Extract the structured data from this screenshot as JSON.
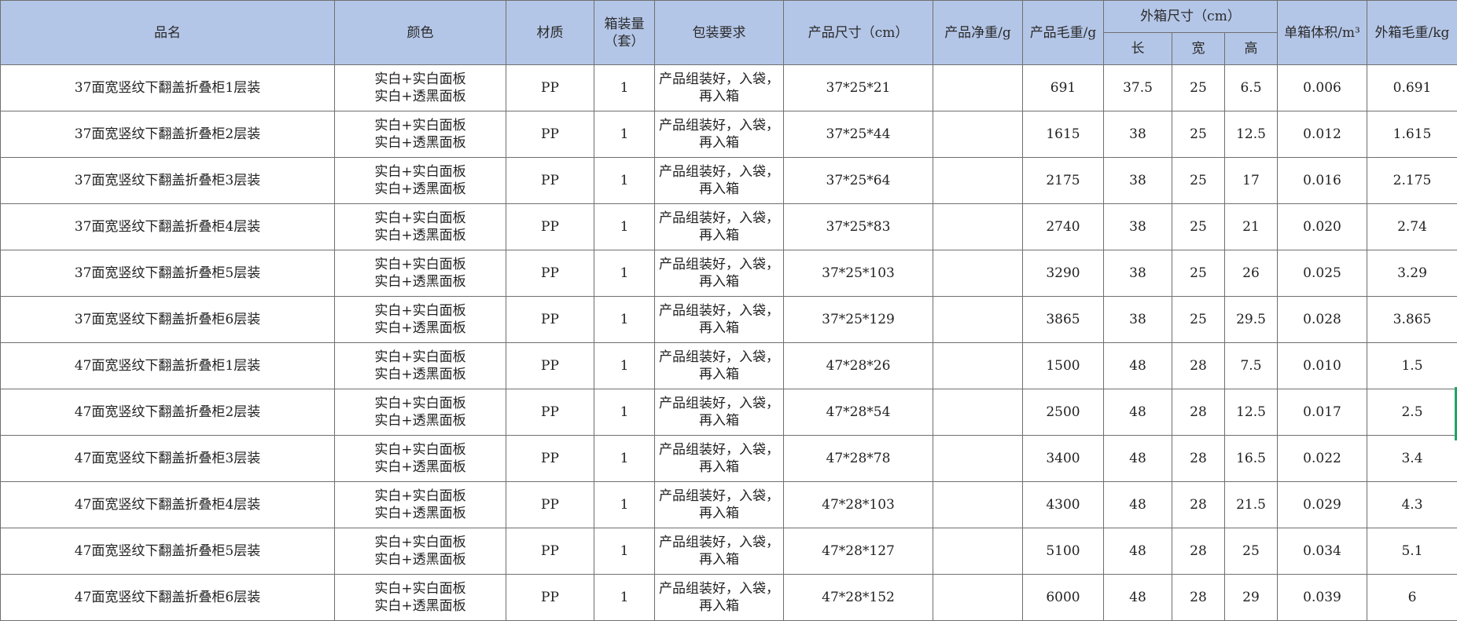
{
  "headers": {
    "name": "品名",
    "color": "颜色",
    "material": "材质",
    "qty": "箱装量（套）",
    "packing": "包装要求",
    "size": "产品尺寸（cm）",
    "net_weight": "产品净重/g",
    "gross_weight": "产品毛重/g",
    "carton_size": "外箱尺寸（cm）",
    "length": "长",
    "width": "宽",
    "height": "高",
    "volume": "单箱体积/m³",
    "carton_gross": "外箱毛重/kg"
  },
  "colors": {
    "header_bg": "#b4c6e7",
    "border": "#6f6f6f",
    "selection_mark": "#21a366"
  },
  "rows": [
    {
      "name": "37面宽竖纹下翻盖折叠柜1层装",
      "color1": "实白+实白面板",
      "color2": "实白+透黑面板",
      "material": "PP",
      "qty": "1",
      "packing": "产品组装好，入袋，再入箱",
      "size": "37*25*21",
      "net": "",
      "gross": "691",
      "l": "37.5",
      "w": "25",
      "h": "6.5",
      "vol": "0.006",
      "cgross": "0.691"
    },
    {
      "name": "37面宽竖纹下翻盖折叠柜2层装",
      "color1": "实白+实白面板",
      "color2": "实白+透黑面板",
      "material": "PP",
      "qty": "1",
      "packing": "产品组装好，入袋，再入箱",
      "size": "37*25*44",
      "net": "",
      "gross": "1615",
      "l": "38",
      "w": "25",
      "h": "12.5",
      "vol": "0.012",
      "cgross": "1.615"
    },
    {
      "name": "37面宽竖纹下翻盖折叠柜3层装",
      "color1": "实白+实白面板",
      "color2": "实白+透黑面板",
      "material": "PP",
      "qty": "1",
      "packing": "产品组装好，入袋，再入箱",
      "size": "37*25*64",
      "net": "",
      "gross": "2175",
      "l": "38",
      "w": "25",
      "h": "17",
      "vol": "0.016",
      "cgross": "2.175"
    },
    {
      "name": "37面宽竖纹下翻盖折叠柜4层装",
      "color1": "实白+实白面板",
      "color2": "实白+透黑面板",
      "material": "PP",
      "qty": "1",
      "packing": "产品组装好，入袋，再入箱",
      "size": "37*25*83",
      "net": "",
      "gross": "2740",
      "l": "38",
      "w": "25",
      "h": "21",
      "vol": "0.020",
      "cgross": "2.74"
    },
    {
      "name": "37面宽竖纹下翻盖折叠柜5层装",
      "color1": "实白+实白面板",
      "color2": "实白+透黑面板",
      "material": "PP",
      "qty": "1",
      "packing": "产品组装好，入袋，再入箱",
      "size": "37*25*103",
      "net": "",
      "gross": "3290",
      "l": "38",
      "w": "25",
      "h": "26",
      "vol": "0.025",
      "cgross": "3.29"
    },
    {
      "name": "37面宽竖纹下翻盖折叠柜6层装",
      "color1": "实白+实白面板",
      "color2": "实白+透黑面板",
      "material": "PP",
      "qty": "1",
      "packing": "产品组装好，入袋，再入箱",
      "size": "37*25*129",
      "net": "",
      "gross": "3865",
      "l": "38",
      "w": "25",
      "h": "29.5",
      "vol": "0.028",
      "cgross": "3.865"
    },
    {
      "name": "47面宽竖纹下翻盖折叠柜1层装",
      "color1": "实白+实白面板",
      "color2": "实白+透黑面板",
      "material": "PP",
      "qty": "1",
      "packing": "产品组装好，入袋，再入箱",
      "size": "47*28*26",
      "net": "",
      "gross": "1500",
      "l": "48",
      "w": "28",
      "h": "7.5",
      "vol": "0.010",
      "cgross": "1.5"
    },
    {
      "name": "47面宽竖纹下翻盖折叠柜2层装",
      "color1": "实白+实白面板",
      "color2": "实白+透黑面板",
      "material": "PP",
      "qty": "1",
      "packing": "产品组装好，入袋，再入箱",
      "size": "47*28*54",
      "net": "",
      "gross": "2500",
      "l": "48",
      "w": "28",
      "h": "12.5",
      "vol": "0.017",
      "cgross": "2.5"
    },
    {
      "name": "47面宽竖纹下翻盖折叠柜3层装",
      "color1": "实白+实白面板",
      "color2": "实白+透黑面板",
      "material": "PP",
      "qty": "1",
      "packing": "产品组装好，入袋，再入箱",
      "size": "47*28*78",
      "net": "",
      "gross": "3400",
      "l": "48",
      "w": "28",
      "h": "16.5",
      "vol": "0.022",
      "cgross": "3.4"
    },
    {
      "name": "47面宽竖纹下翻盖折叠柜4层装",
      "color1": "实白+实白面板",
      "color2": "实白+透黑面板",
      "material": "PP",
      "qty": "1",
      "packing": "产品组装好，入袋，再入箱",
      "size": "47*28*103",
      "net": "",
      "gross": "4300",
      "l": "48",
      "w": "28",
      "h": "21.5",
      "vol": "0.029",
      "cgross": "4.3"
    },
    {
      "name": "47面宽竖纹下翻盖折叠柜5层装",
      "color1": "实白+实白面板",
      "color2": "实白+透黑面板",
      "material": "PP",
      "qty": "1",
      "packing": "产品组装好，入袋，再入箱",
      "size": "47*28*127",
      "net": "",
      "gross": "5100",
      "l": "48",
      "w": "28",
      "h": "25",
      "vol": "0.034",
      "cgross": "5.1"
    },
    {
      "name": "47面宽竖纹下翻盖折叠柜6层装",
      "color1": "实白+实白面板",
      "color2": "实白+透黑面板",
      "material": "PP",
      "qty": "1",
      "packing": "产品组装好，入袋，再入箱",
      "size": "47*28*152",
      "net": "",
      "gross": "6000",
      "l": "48",
      "w": "28",
      "h": "29",
      "vol": "0.039",
      "cgross": "6"
    }
  ]
}
